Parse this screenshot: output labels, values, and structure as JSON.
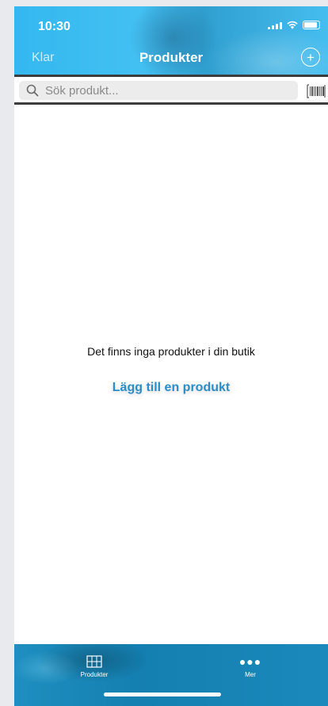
{
  "status_bar": {
    "time": "10:30"
  },
  "nav": {
    "left_label": "Klar",
    "title": "Produkter",
    "add_icon": "plus-circle-icon"
  },
  "search": {
    "placeholder": "Sök produkt...",
    "value": "",
    "barcode_icon": "barcode-scanner-icon"
  },
  "empty_state": {
    "message": "Det finns inga produkter i din butik",
    "action_label": "Lägg till en produkt"
  },
  "tabbar": {
    "tabs": [
      {
        "label": "Produkter",
        "icon": "grid-icon"
      },
      {
        "label": "Mer",
        "icon": "ellipsis-icon"
      }
    ]
  },
  "colors": {
    "header_blue": "#3fbcef",
    "tabbar_blue": "#1886b8",
    "link_blue": "#2a8fc8"
  }
}
